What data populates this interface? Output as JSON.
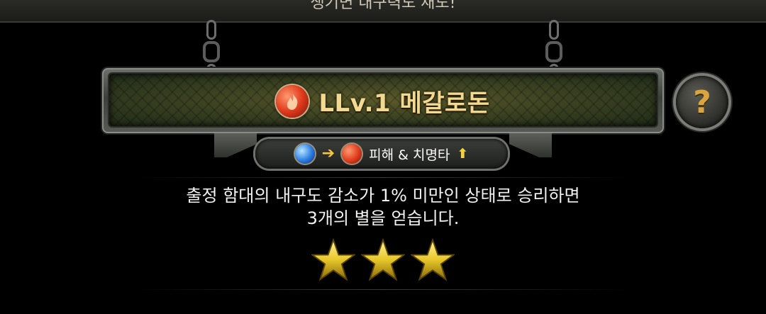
{
  "top_text": "생기면 내구력도 재도!",
  "stage": {
    "icon": "fire-element-icon",
    "title": "LLv.1 메갈로돈"
  },
  "bonus": {
    "from_icon": "water-element-icon",
    "arrow": "➔",
    "to_icon": "fire-element-icon",
    "label": "피해 & 치명타",
    "up_arrow": "⬆"
  },
  "help_label": "?",
  "condition": {
    "line1": "출정 함대의 내구도 감소가 1% 미만인 상태로 승리하면",
    "line2": "3개의 별을 얻습니다."
  },
  "stars_earned": 3,
  "colors": {
    "title": "#f2d98f",
    "star": "#e8c72a",
    "accent": "#f5c542"
  }
}
